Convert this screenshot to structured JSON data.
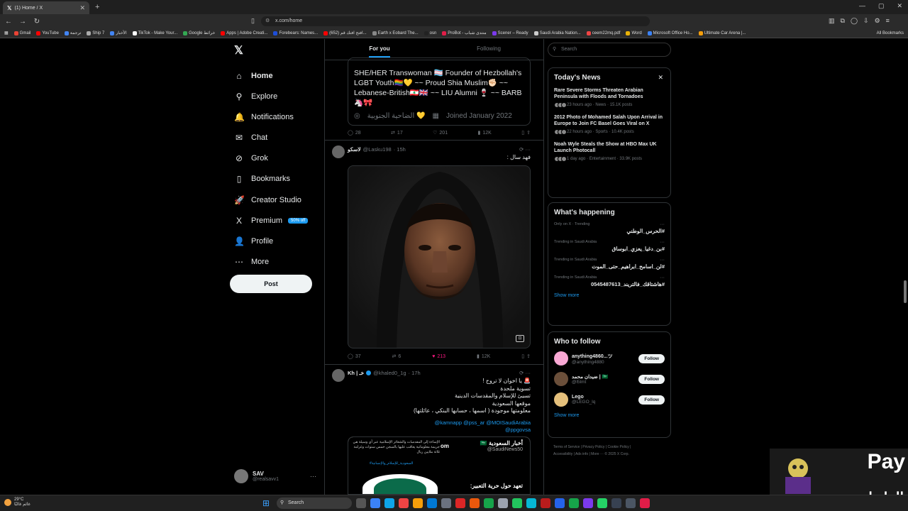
{
  "browser": {
    "tab_title": "(1) Home / X",
    "new_tab": "+",
    "url": "x.com/home",
    "all_bookmarks": "All Bookmarks",
    "bookmarks": [
      {
        "label": "Gmail",
        "color": "#ea4335"
      },
      {
        "label": "YouTube",
        "color": "#ff0000"
      },
      {
        "label": "ترجمة",
        "color": "#4285f4"
      },
      {
        "label": "Ship 7",
        "color": "#aaaaaa"
      },
      {
        "label": "الأخبار",
        "color": "#4285f4"
      },
      {
        "label": "TikTok - Make Your...",
        "color": "#ffffff"
      },
      {
        "label": "Google خرائط",
        "color": "#34a853"
      },
      {
        "label": "Apps | Adobe Creati...",
        "color": "#ff0000"
      },
      {
        "label": "Forebears: Names...",
        "color": "#1d4ed8"
      },
      {
        "label": "(652) افتح افتك قم...",
        "color": "#ff0000"
      },
      {
        "label": "Earth x Eobard The...",
        "color": "#888888"
      },
      {
        "label": "osn",
        "color": "#222222"
      },
      {
        "label": "ProBot - منتدى شباب",
        "color": "#e11d48"
      },
      {
        "label": "Scener – Ready",
        "color": "#7c3aed"
      },
      {
        "label": "Saudi Arabia Nation...",
        "color": "#cccccc"
      },
      {
        "label": "ceem22mq.pdf",
        "color": "#ef4444"
      },
      {
        "label": "Word",
        "color": "#eab308"
      },
      {
        "label": "Microsoft Office Ho...",
        "color": "#3b82f6"
      },
      {
        "label": "Ultimate Car Arena |...",
        "color": "#f59e0b"
      }
    ]
  },
  "nav": {
    "items": [
      {
        "label": "Home",
        "icon": "home-icon",
        "glyph": "⌂"
      },
      {
        "label": "Explore",
        "icon": "search-icon",
        "glyph": "⚲"
      },
      {
        "label": "Notifications",
        "icon": "bell-icon",
        "glyph": "🔔"
      },
      {
        "label": "Chat",
        "icon": "mail-icon",
        "glyph": "✉"
      },
      {
        "label": "Grok",
        "icon": "grok-icon",
        "glyph": "⊘"
      },
      {
        "label": "Bookmarks",
        "icon": "bookmark-icon",
        "glyph": "▯"
      },
      {
        "label": "Creator Studio",
        "icon": "rocket-icon",
        "glyph": "🚀"
      },
      {
        "label": "Premium",
        "icon": "x-icon",
        "glyph": "X"
      },
      {
        "label": "Profile",
        "icon": "person-icon",
        "glyph": "👤"
      },
      {
        "label": "More",
        "icon": "more-circle-icon",
        "glyph": "⋯"
      }
    ],
    "premium_badge": "50% off",
    "post_label": "Post",
    "account": {
      "name": "SAV",
      "handle": "@realsavv1",
      "more": "···"
    }
  },
  "feed": {
    "tabs": [
      "For you",
      "Following"
    ],
    "quote": {
      "bio_lines": [
        "SHE/HER Transwoman 🏳️‍⚧️ Founder of Hezbollah's",
        "LGBT Youth🏳️‍🌈💛 ~~ Proud Shia Muslim✊🏻 ~~",
        "Lebanese-British🇱🇧🇬🇧 ~~ LIU Alumni 🍷 ~~ BARB",
        "🦄🎀"
      ],
      "location": "الضاحية الجنوبية 💛",
      "joined": "Joined January 2022"
    },
    "actions1": {
      "reply": "28",
      "repost": "17",
      "like": "201",
      "views": "12K"
    },
    "tweet2": {
      "name": "لاسكو",
      "handle": "@Lasku198",
      "time": "· 15h",
      "text": "فهد سال :"
    },
    "actions2": {
      "reply": "37",
      "repost": "6",
      "like": "213",
      "views": "12K"
    },
    "tweet3": {
      "name": "Kh | خـ",
      "handle": "@khaled0_1g",
      "time": "· 17h",
      "lines": [
        "🚨 يا اخوان لا تروح !",
        "تسوية ملحدة",
        "تسيئ للإسلام والمقدسات الدينية",
        "موقعها السعودية",
        "معلومتها موجودة ( اسمها ، حسابها البنكي ، عائلتها)"
      ],
      "links": [
        "@kamnapp @pss_ar @MOISaudiArabia",
        "@ppgovsa"
      ]
    },
    "embed": {
      "account": "أخبار السعودية 🇸🇦",
      "handle": "@SaudiNews50",
      "headline": "تعهد حول حرية التعبير:",
      "om": "om",
      "body": "الإساءة إلى المقدسات والشعائر الإسلامية عبر أي وسيلة هي جريمة معلوماتية يعاقب عليها بالسجن خمس سنوات وغرامة ثلاثة ملايين ريال",
      "hashtag": "#السعودية_للإسلام_والإنسانية"
    }
  },
  "right": {
    "search_placeholder": "Search",
    "news": {
      "title": "Today's News",
      "items": [
        {
          "title": "Rare Severe Storms Threaten Arabian Peninsula with Floods and Tornadoes",
          "meta": "23 hours ago · News · 15.1K posts"
        },
        {
          "title": "2012 Photo of Mohamed Salah Upon Arrival in Europe to Join FC Basel Goes Viral on X",
          "meta": "22 hours ago · Sports · 10.4K posts"
        },
        {
          "title": "Noah Wyle Steals the Show at HBO Max UK Launch Photocall",
          "meta": "1 day ago · Entertainment · 33.9K posts"
        }
      ]
    },
    "happening": {
      "title": "What's happening",
      "items": [
        {
          "context": "Only on X · Trending",
          "tag": "#الحرس_الوطني"
        },
        {
          "context": "Trending in Saudi Arabia",
          "tag": "#بن_دغيا_يعزي_ابوساق"
        },
        {
          "context": "Trending in Saudi Arabia",
          "tag": "#لن_اسامح_ابراهيم_حتى_الموت"
        },
        {
          "context": "Trending in Saudi Arabia",
          "tag": "#هاشتاقك_فالتريند_0545487613"
        }
      ],
      "show_more": "Show more"
    },
    "follow": {
      "title": "Who to follow",
      "items": [
        {
          "name": "anything4860...ツ",
          "handle": "@anything4880",
          "btn": "Follow",
          "color": "#f9a8d4"
        },
        {
          "name": "ضيدان محمد | 🇸🇦",
          "handle": "@l5lmt",
          "btn": "Follow",
          "color": "#6b4f3a"
        },
        {
          "name": "Lego",
          "handle": "@LEGO_lq",
          "btn": "Follow",
          "color": "#e5c07b"
        }
      ],
      "show_more": "Show more"
    },
    "footer": {
      "line1": "Terms of Service | Privacy Policy | Cookie Policy |",
      "line2": "Accessibility | Ads info | More ··· © 2025 X Corp."
    }
  },
  "overlay": {
    "pay": "Pay",
    "arabic": "الرابط تحت"
  },
  "taskbar": {
    "temp": "29°C",
    "weather": "غائم غالبًا",
    "search": "Search"
  }
}
